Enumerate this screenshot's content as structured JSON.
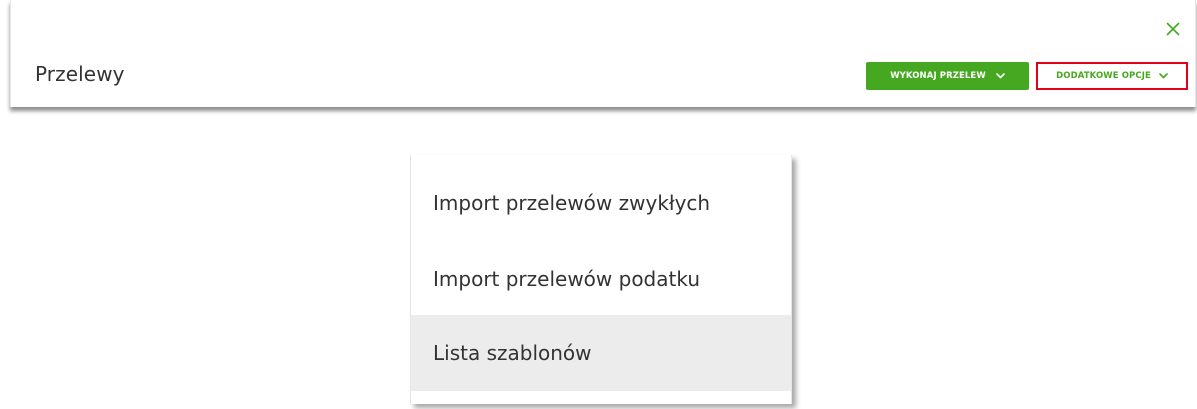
{
  "header": {
    "title": "Przelewy",
    "close_icon": "close-icon",
    "primary_button": {
      "label": "WYKONAJ PRZELEW",
      "icon": "chevron-down-icon",
      "color": "#46a820"
    },
    "secondary_button": {
      "label": "DODATKOWE OPCJE",
      "icon": "chevron-down-icon",
      "color": "#46a820",
      "highlight_border": "#e2001a"
    }
  },
  "dropdown": {
    "items": [
      {
        "label": "Import przelewów zwykłych"
      },
      {
        "label": "Import przelewów podatku"
      },
      {
        "label": "Lista szablonów",
        "hovered": true
      }
    ]
  },
  "colors": {
    "accent_green": "#46a820",
    "highlight_red": "#e2001a",
    "hover_bg": "#ececec",
    "text": "#333333"
  }
}
